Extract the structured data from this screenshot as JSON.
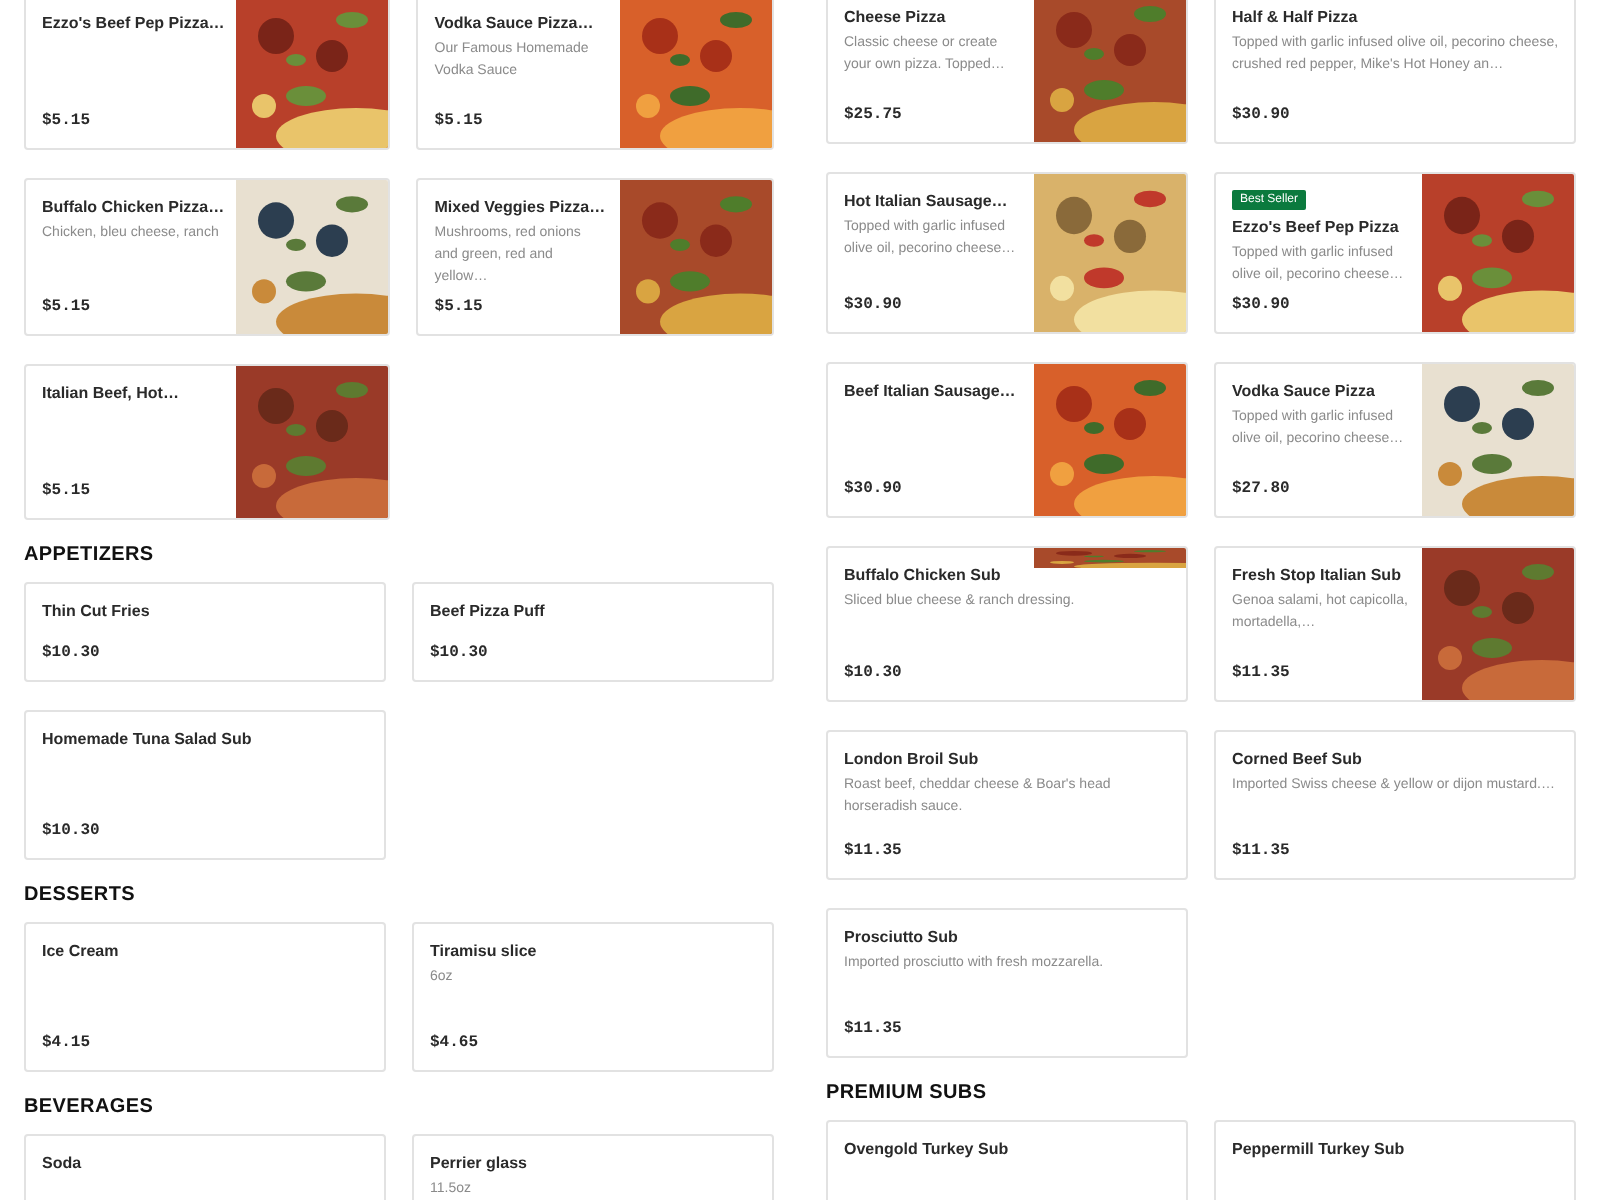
{
  "columns": [
    {
      "sections": [
        {
          "items": [
            {
              "name": "Ezzo's Beef Pep Pizza…",
              "price": "$5.15",
              "kind": "picture",
              "compact": false
            },
            {
              "name": "Vodka Sauce Pizza…",
              "description": "Our Famous Homemade Vodka Sauce",
              "price": "$5.15",
              "kind": "picture",
              "compact": false
            },
            {
              "name": "Buffalo Chicken Pizza…",
              "description": "Chicken, bleu cheese, ranch",
              "price": "$5.15",
              "kind": "picture",
              "compact": false
            },
            {
              "name": "Mixed Veggies Pizza…",
              "description": "Mushrooms, red onions and green, red and yellow…",
              "price": "$5.15",
              "kind": "picture",
              "compact": false
            },
            {
              "name": "Italian Beef, Hot…",
              "price": "$5.15",
              "kind": "picture",
              "compact": false
            }
          ]
        },
        {
          "heading": "APPETIZERS",
          "items": [
            {
              "name": "Thin Cut Fries",
              "price": "$10.30",
              "compact": true
            },
            {
              "name": "Beef Pizza Puff",
              "price": "$10.30",
              "compact": true
            },
            {
              "name": "Homemade Tuna Salad Sub",
              "price": "$10.30",
              "compact": false
            }
          ]
        },
        {
          "heading": "DESSERTS",
          "items": [
            {
              "name": "Ice Cream",
              "price": "$4.15",
              "compact": false
            },
            {
              "name": "Tiramisu slice",
              "description": "6oz",
              "price": "$4.65",
              "compact": false
            }
          ]
        },
        {
          "heading": "BEVERAGES",
          "items": [
            {
              "name": "Soda",
              "compact": false
            },
            {
              "name": "Perrier glass",
              "description": "11.5oz",
              "compact": false
            }
          ]
        }
      ]
    },
    {
      "sections": [
        {
          "items": [
            {
              "name": "Cheese Pizza",
              "description": "Classic cheese or create your own pizza. Topped…",
              "price": "$25.75",
              "kind": "picture",
              "compact": false
            },
            {
              "name": "Half & Half Pizza",
              "description": "Topped with garlic infused olive oil, pecorino cheese, crushed red pepper, Mike's Hot Honey an…",
              "price": "$30.90",
              "compact": false
            },
            {
              "name": "Hot Italian Sausage…",
              "description": "Topped with garlic infused olive oil, pecorino cheese…",
              "price": "$30.90",
              "kind": "picture",
              "compact": false
            },
            {
              "name": "Ezzo's Beef Pep Pizza",
              "badge": "Best Seller",
              "description": "Topped with garlic infused olive oil, pecorino cheese…",
              "price": "$30.90",
              "kind": "picture",
              "compact": false
            },
            {
              "name": "Beef Italian Sausage…",
              "price": "$30.90",
              "kind": "picture",
              "compact": false
            },
            {
              "name": "Vodka Sauce Pizza",
              "description": "Topped with garlic infused olive oil, pecorino cheese…",
              "price": "$27.80",
              "kind": "picture",
              "compact": false
            },
            {
              "name": "Buffalo Chicken Sub",
              "description": "Sliced blue cheese & ranch dressing.",
              "price": "$10.30",
              "kind": "strip",
              "compact": false
            },
            {
              "name": "Fresh Stop Italian Sub",
              "description": "Genoa salami, hot capicolla, mortadella,…",
              "price": "$11.35",
              "kind": "picture",
              "compact": false
            },
            {
              "name": "London Broil Sub",
              "description": "Roast beef, cheddar cheese & Boar's head horseradish sauce.",
              "price": "$11.35",
              "compact": false
            },
            {
              "name": "Corned Beef Sub",
              "description": "Imported Swiss cheese & yellow or dijon mustard.…",
              "price": "$11.35",
              "compact": false
            },
            {
              "name": "Prosciutto Sub",
              "description": "Imported prosciutto with fresh mozzarella.",
              "price": "$11.35",
              "compact": false
            }
          ]
        },
        {
          "heading": "PREMIUM SUBS",
          "items": [
            {
              "name": "Ovengold Turkey Sub",
              "compact": false
            },
            {
              "name": "Peppermill Turkey Sub",
              "compact": false
            }
          ]
        }
      ]
    }
  ]
}
